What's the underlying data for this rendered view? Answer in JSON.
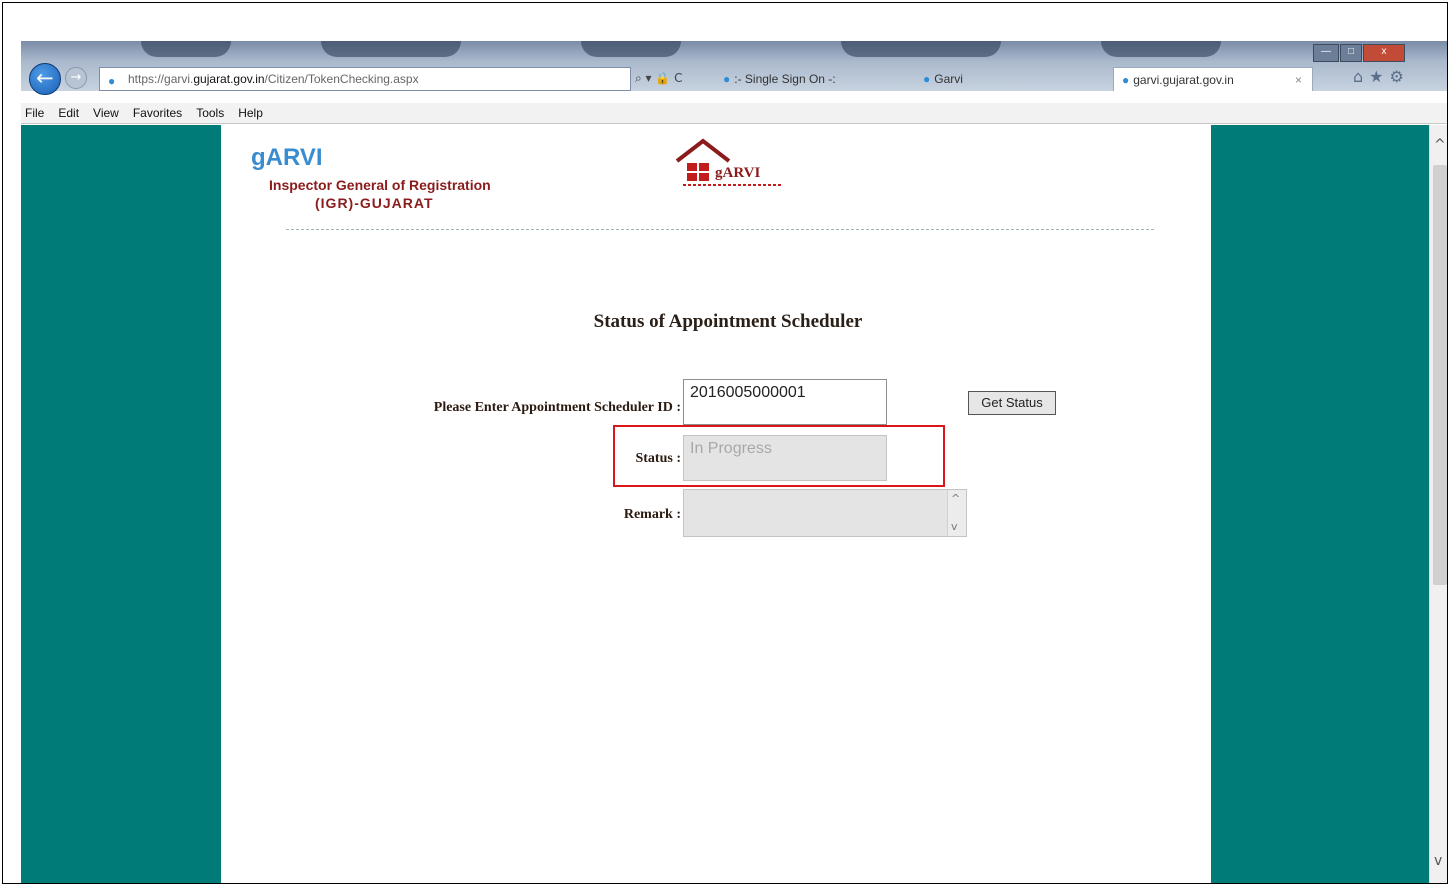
{
  "browser": {
    "address": {
      "prefix": "https://garvi.",
      "host": "gujarat.gov.in",
      "path": "/Citizen/TokenChecking.aspx"
    },
    "address_icons": "⌕ ▾ 🔒 C",
    "tabs": [
      {
        "label": ":- Single Sign On -:"
      },
      {
        "label": "Garvi"
      },
      {
        "label": "garvi.gujarat.gov.in"
      }
    ],
    "tab_close": "×",
    "menu": [
      "File",
      "Edit",
      "View",
      "Favorites",
      "Tools",
      "Help"
    ],
    "window_controls": {
      "minimize": "—",
      "maximize": "□",
      "close": "x"
    },
    "toolbar_icons": "⌂★⚙",
    "back_icon": "←",
    "forward_icon": "→"
  },
  "header": {
    "brand_name": "gARVI",
    "brand_line1": "Inspector General of Registration",
    "brand_line2": "(IGR)-GUJARAT",
    "logo_text": "gARVI"
  },
  "form": {
    "heading": "Status of Appointment Scheduler",
    "id_label": "Please Enter Appointment Scheduler ID :",
    "id_value": "2016005000001",
    "get_status_label": "Get Status",
    "status_label": "Status :",
    "status_value": "In Progress",
    "remark_label": "Remark :",
    "remark_value": ""
  },
  "colors": {
    "side_band": "#007b78",
    "brand_blue": "#3a8cd0",
    "brand_maroon": "#8a1c1c",
    "highlight_red": "#d9161c"
  }
}
